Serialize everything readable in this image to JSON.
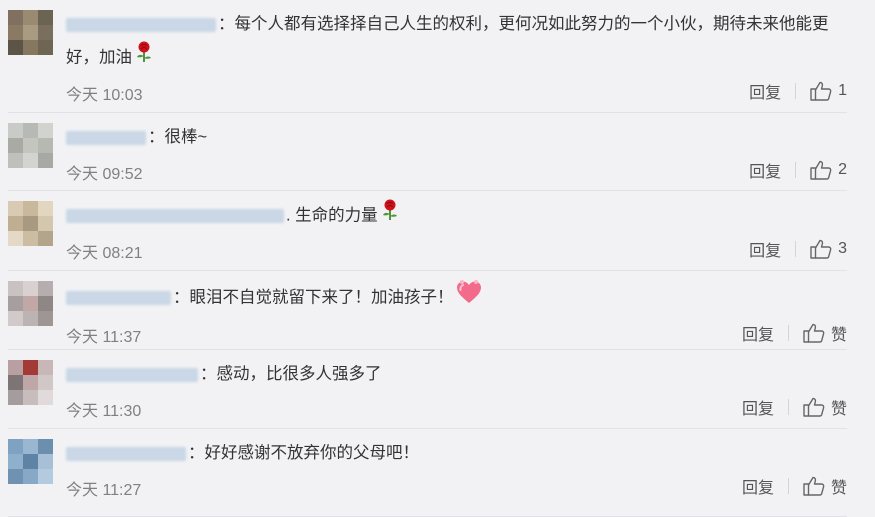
{
  "reply_label": "回复",
  "comments": [
    {
      "text": "：每个人都有选择择自己人生的权利，更何况如此努力的一个小伙，期待未来他能更好，加油",
      "emoji": "rose-emoji",
      "time": "今天 10:03",
      "likes": "1",
      "avatar": [
        "#7f7060",
        "#9a8a72",
        "#6b6452",
        "#8b7a63",
        "#a99a82",
        "#7a6e5e",
        "#5c5446",
        "#867760",
        "#6e6553"
      ]
    },
    {
      "text": "：很棒~",
      "emoji": "",
      "time": "今天 09:52",
      "likes": "2",
      "avatar": [
        "#c9cbc9",
        "#b7b9b5",
        "#d2d3cf",
        "#a9aaa4",
        "#c4c5bf",
        "#b6b8b2",
        "#bfc0bc",
        "#d3d4d0",
        "#a8a9a4"
      ]
    },
    {
      "text": ". 生命的力量",
      "emoji": "rose-emoji",
      "time": "今天 08:21",
      "likes": "3",
      "avatar": [
        "#d9cbb3",
        "#c8b89c",
        "#e3d6c1",
        "#bfae92",
        "#a89a80",
        "#d5c7ae",
        "#e4d8c6",
        "#cbbca2",
        "#b3a58c"
      ]
    },
    {
      "text": "：眼泪不自觉就留下来了！加油孩子！",
      "emoji": "heart-emoji",
      "time": "今天 11:37",
      "likes": "赞",
      "avatar": [
        "#c8c2c2",
        "#d9d0d0",
        "#b6aeae",
        "#a79e9f",
        "#c1a8a6",
        "#8f8686",
        "#d2caca",
        "#bcb3b3",
        "#9e9595"
      ]
    },
    {
      "text": "：感动，比很多人强多了",
      "emoji": "",
      "time": "今天 11:30",
      "likes": "赞",
      "avatar": [
        "#b8a0a2",
        "#a23a36",
        "#c9b6b6",
        "#7d7476",
        "#bfa7a8",
        "#d2c7c7",
        "#a59c9d",
        "#c7bdbd",
        "#e1dada"
      ]
    },
    {
      "text": "：好好感谢不放弃你的父母吧！",
      "emoji": "",
      "time": "今天 11:27",
      "likes": "赞",
      "avatar": [
        "#7fa2c3",
        "#9ab7d2",
        "#6c8fae",
        "#8fb0cc",
        "#5f83a4",
        "#a7c0d7",
        "#6f92b2",
        "#88a9c6",
        "#b4cadf"
      ]
    }
  ]
}
